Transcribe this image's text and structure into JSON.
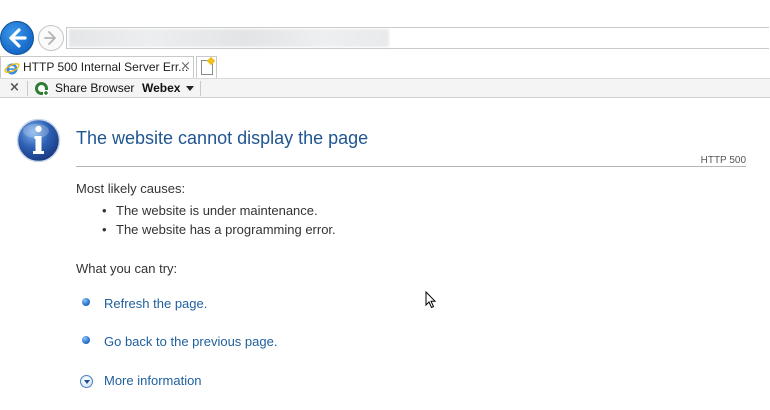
{
  "browser": {
    "tab": {
      "title": "HTTP 500 Internal Server Err...",
      "close_glyph": "×",
      "favicon": "ie-icon"
    },
    "nav": {
      "back_icon": "back-arrow-icon",
      "forward_icon": "forward-arrow-icon"
    },
    "toolbar": {
      "close_glyph": "×",
      "share_label": "Share Browser",
      "webex_label": "Webex"
    }
  },
  "error_page": {
    "title": "The website cannot display the page",
    "code": "HTTP 500",
    "causes_heading": "Most likely causes:",
    "causes": [
      "The website is under maintenance.",
      "The website has a programming error."
    ],
    "try_heading": "What you can try:",
    "actions": [
      "Refresh the page.",
      "Go back to the previous page."
    ],
    "more_info": "More information",
    "bullet": "•"
  },
  "colors": {
    "title": "#1f5590",
    "link": "#1e5f9e",
    "back_button": "#1a6fcd"
  }
}
